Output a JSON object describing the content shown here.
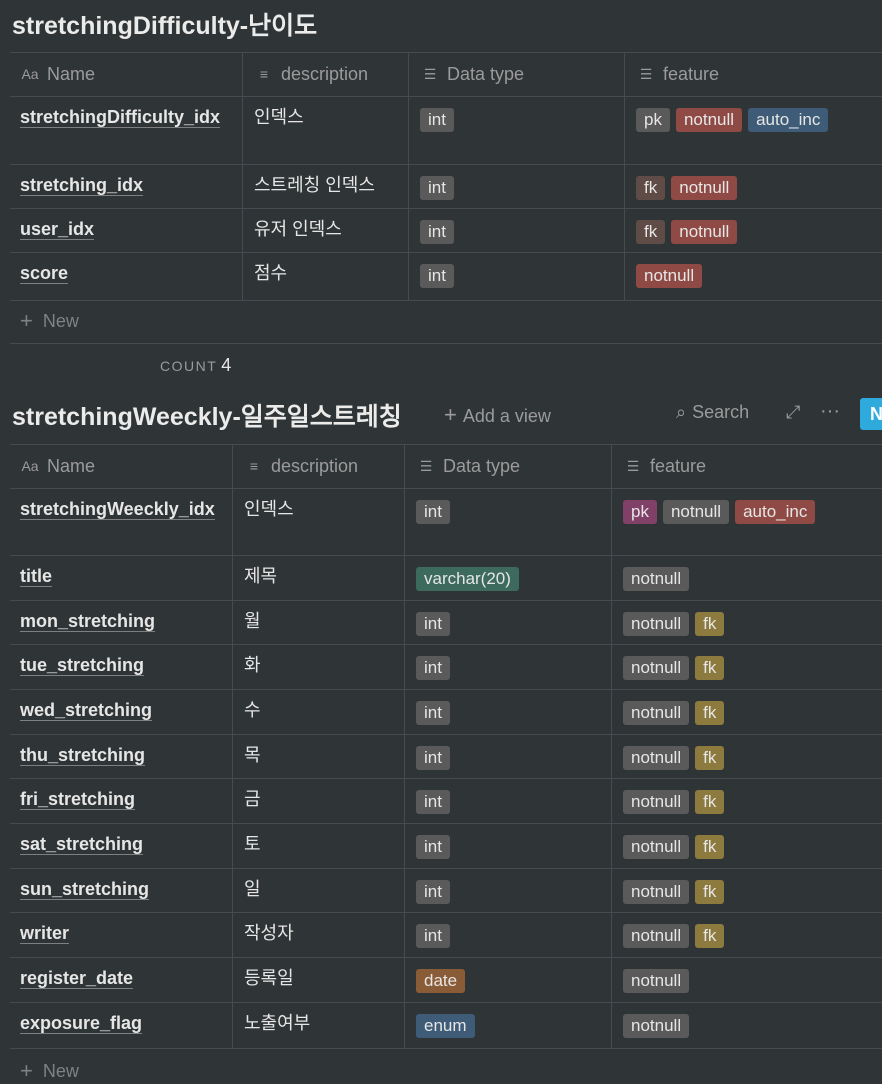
{
  "table1": {
    "title": "stretchingDifficulty-난이도",
    "headers": {
      "name": "Name",
      "description": "description",
      "datatype": "Data type",
      "feature": "feature"
    },
    "rows": [
      {
        "name": "stretchingDifficulty_idx",
        "desc": "인덱스",
        "type": {
          "label": "int",
          "color": "gray"
        },
        "features": [
          {
            "label": "pk",
            "color": "gray"
          },
          {
            "label": "notnull",
            "color": "red"
          },
          {
            "label": "auto_inc",
            "color": "blue"
          }
        ]
      },
      {
        "name": "stretching_idx",
        "desc": "스트레칭 인덱스",
        "type": {
          "label": "int",
          "color": "gray"
        },
        "features": [
          {
            "label": "fk",
            "color": "brown"
          },
          {
            "label": "notnull",
            "color": "red"
          }
        ]
      },
      {
        "name": "user_idx",
        "desc": "유저 인덱스",
        "type": {
          "label": "int",
          "color": "gray"
        },
        "features": [
          {
            "label": "fk",
            "color": "brown"
          },
          {
            "label": "notnull",
            "color": "red"
          }
        ]
      },
      {
        "name": "score",
        "desc": "점수",
        "type": {
          "label": "int",
          "color": "gray"
        },
        "features": [
          {
            "label": "notnull",
            "color": "red"
          }
        ]
      }
    ],
    "new_label": "New",
    "count_label": "COUNT",
    "count_value": "4"
  },
  "table2": {
    "title": "stretchingWeeckly-일주일스트레칭",
    "add_view_label": "Add a view",
    "search_label": "Search",
    "new_button_label": "N",
    "headers": {
      "name": "Name",
      "description": "description",
      "datatype": "Data type",
      "feature": "feature"
    },
    "rows": [
      {
        "name": "stretchingWeeckly_idx",
        "desc": "인덱스",
        "type": {
          "label": "int",
          "color": "gray"
        },
        "features": [
          {
            "label": "pk",
            "color": "pink"
          },
          {
            "label": "notnull",
            "color": "gray"
          },
          {
            "label": "auto_inc",
            "color": "red"
          }
        ]
      },
      {
        "name": "title",
        "desc": "제목",
        "type": {
          "label": "varchar(20)",
          "color": "green"
        },
        "features": [
          {
            "label": "notnull",
            "color": "gray"
          }
        ]
      },
      {
        "name": "mon_stretching",
        "desc": "월",
        "type": {
          "label": "int",
          "color": "gray"
        },
        "features": [
          {
            "label": "notnull",
            "color": "gray"
          },
          {
            "label": "fk",
            "color": "yellow"
          }
        ]
      },
      {
        "name": "tue_stretching",
        "desc": "화",
        "type": {
          "label": "int",
          "color": "gray"
        },
        "features": [
          {
            "label": "notnull",
            "color": "gray"
          },
          {
            "label": "fk",
            "color": "yellow"
          }
        ]
      },
      {
        "name": "wed_stretching",
        "desc": "수",
        "type": {
          "label": "int",
          "color": "gray"
        },
        "features": [
          {
            "label": "notnull",
            "color": "gray"
          },
          {
            "label": "fk",
            "color": "yellow"
          }
        ]
      },
      {
        "name": "thu_stretching",
        "desc": "목",
        "type": {
          "label": "int",
          "color": "gray"
        },
        "features": [
          {
            "label": "notnull",
            "color": "gray"
          },
          {
            "label": "fk",
            "color": "yellow"
          }
        ]
      },
      {
        "name": "fri_stretching",
        "desc": "금",
        "type": {
          "label": "int",
          "color": "gray"
        },
        "features": [
          {
            "label": "notnull",
            "color": "gray"
          },
          {
            "label": "fk",
            "color": "yellow"
          }
        ]
      },
      {
        "name": "sat_stretching",
        "desc": "토",
        "type": {
          "label": "int",
          "color": "gray"
        },
        "features": [
          {
            "label": "notnull",
            "color": "gray"
          },
          {
            "label": "fk",
            "color": "yellow"
          }
        ]
      },
      {
        "name": "sun_stretching",
        "desc": "일",
        "type": {
          "label": "int",
          "color": "gray"
        },
        "features": [
          {
            "label": "notnull",
            "color": "gray"
          },
          {
            "label": "fk",
            "color": "yellow"
          }
        ]
      },
      {
        "name": "writer",
        "desc": "작성자",
        "type": {
          "label": "int",
          "color": "gray"
        },
        "features": [
          {
            "label": "notnull",
            "color": "gray"
          },
          {
            "label": "fk",
            "color": "yellow"
          }
        ]
      },
      {
        "name": "register_date",
        "desc": "등록일",
        "type": {
          "label": "date",
          "color": "orange"
        },
        "features": [
          {
            "label": "notnull",
            "color": "gray"
          }
        ]
      },
      {
        "name": "exposure_flag",
        "desc": "노출여부",
        "type": {
          "label": "enum",
          "color": "blue"
        },
        "features": [
          {
            "label": "notnull",
            "color": "gray"
          }
        ]
      }
    ],
    "new_label": "New"
  }
}
